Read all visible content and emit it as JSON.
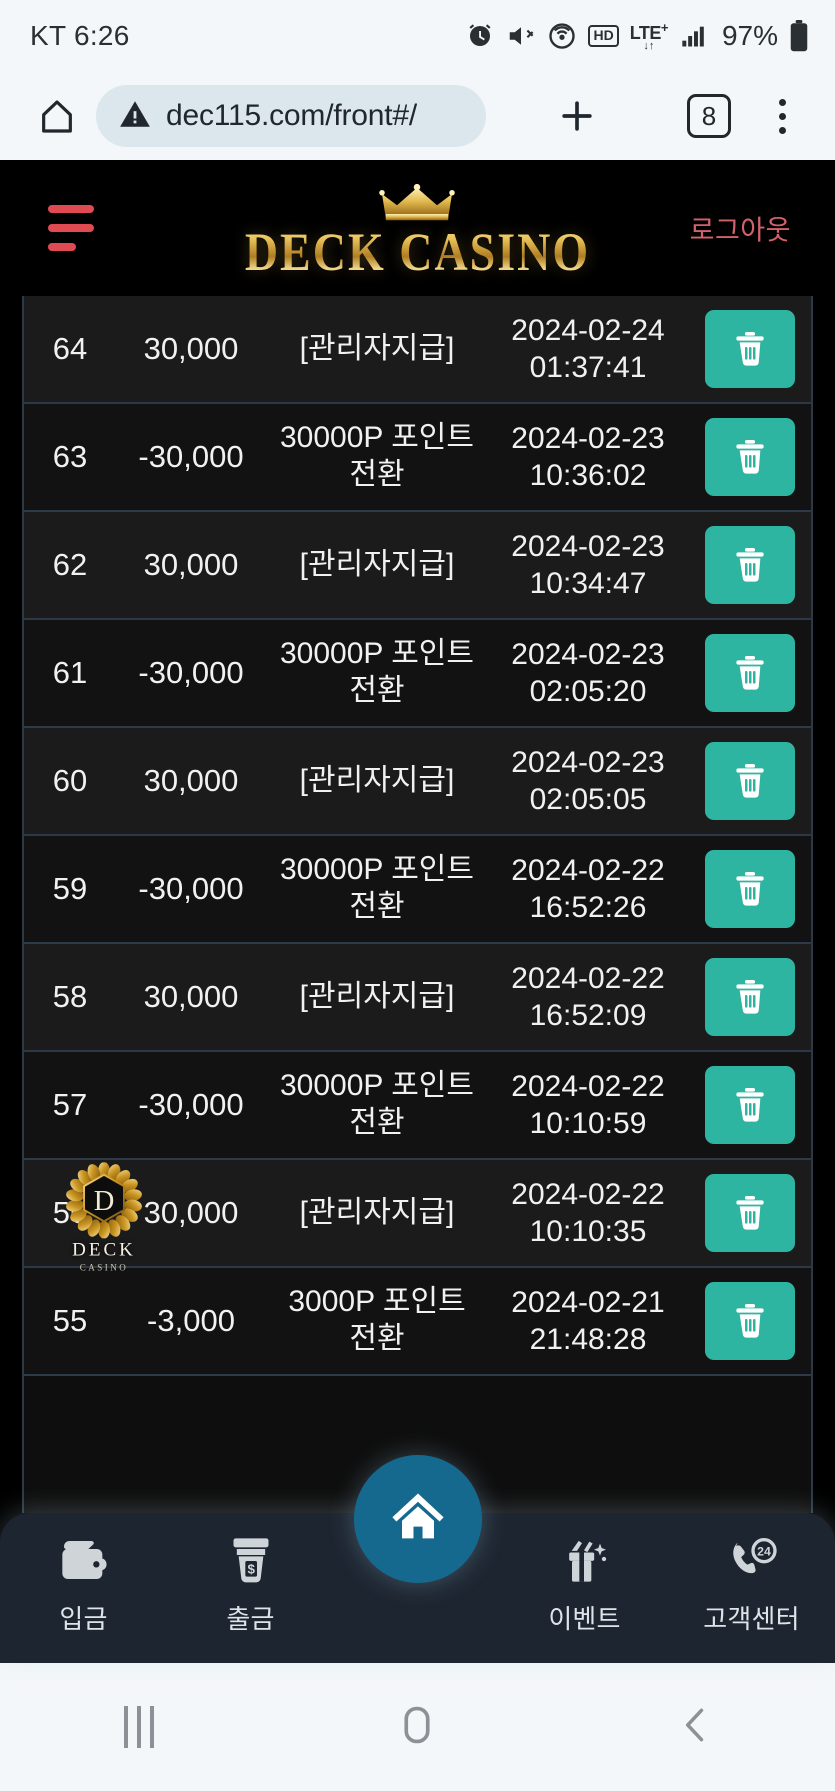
{
  "status_bar": {
    "carrier_time": "KT 6:26",
    "battery_percent": "97%",
    "icons": [
      "alarm-icon",
      "mute-icon",
      "hotspot-icon",
      "hd-icon",
      "lte-plus-icon",
      "signal-icon",
      "battery-icon"
    ],
    "lte_label": "LTE",
    "lte_superscript": "+",
    "hd_label": "HD"
  },
  "browser": {
    "url": "dec115.com/front#/",
    "tab_count": "8",
    "home_icon": "home-icon",
    "warning_icon": "not-secure-warning-icon",
    "new_tab_icon": "plus-icon",
    "menu_icon": "overflow-menu-icon"
  },
  "site_header": {
    "menu_icon": "hamburger-menu-icon",
    "logo_text": "DECK CASINO",
    "logo_crown_icon": "crown-icon",
    "logout_label": "로그아웃",
    "colors": {
      "menu_red": "#e04a52",
      "logout_red": "#d4616b",
      "gold": "#e9c25a"
    }
  },
  "table": {
    "delete_icon": "trash-icon",
    "delete_button_color": "#2eb5a2",
    "watermark": {
      "letter": "D",
      "brand": "DECK",
      "sub": "CASINO",
      "on_row_index": 8
    },
    "rows": [
      {
        "id": "64",
        "amount": "30,000",
        "desc": "[관리자지급]",
        "date": "2024-02-24",
        "time": "01:37:41"
      },
      {
        "id": "63",
        "amount": "-30,000",
        "desc": "30000P 포인트 전환",
        "date": "2024-02-23",
        "time": "10:36:02"
      },
      {
        "id": "62",
        "amount": "30,000",
        "desc": "[관리자지급]",
        "date": "2024-02-23",
        "time": "10:34:47"
      },
      {
        "id": "61",
        "amount": "-30,000",
        "desc": "30000P 포인트 전환",
        "date": "2024-02-23",
        "time": "02:05:20"
      },
      {
        "id": "60",
        "amount": "30,000",
        "desc": "[관리자지급]",
        "date": "2024-02-23",
        "time": "02:05:05"
      },
      {
        "id": "59",
        "amount": "-30,000",
        "desc": "30000P 포인트 전환",
        "date": "2024-02-22",
        "time": "16:52:26"
      },
      {
        "id": "58",
        "amount": "30,000",
        "desc": "[관리자지급]",
        "date": "2024-02-22",
        "time": "16:52:09"
      },
      {
        "id": "57",
        "amount": "-30,000",
        "desc": "30000P 포인트 전환",
        "date": "2024-02-22",
        "time": "10:10:59"
      },
      {
        "id": "56",
        "amount": "30,000",
        "desc": "[관리자지급]",
        "date": "2024-02-22",
        "time": "10:10:35"
      },
      {
        "id": "55",
        "amount": "-3,000",
        "desc": "3000P 포인트 전환",
        "date": "2024-02-21",
        "time": "21:48:28"
      }
    ]
  },
  "app_nav": {
    "items": [
      {
        "label": "입금",
        "icon": "wallet-deposit-icon"
      },
      {
        "label": "출금",
        "icon": "atm-withdraw-icon"
      },
      {
        "label": "이벤트",
        "icon": "gift-event-icon"
      },
      {
        "label": "고객센터",
        "icon": "phone-24-support-icon"
      }
    ],
    "home_icon": "home-icon",
    "home_bubble_color": "#15698f"
  },
  "android_nav": {
    "recents_icon": "recents-icon",
    "home_icon": "home-square-icon",
    "back_icon": "back-chevron-icon"
  }
}
